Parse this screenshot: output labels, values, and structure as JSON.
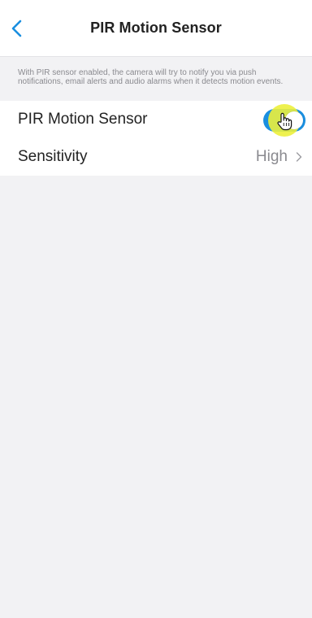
{
  "header": {
    "title": "PIR Motion Sensor"
  },
  "description": "With PIR sensor enabled, the camera will try to notify you via push notifications, email alerts and audio alarms when it detects motion events.",
  "settings": {
    "pir": {
      "label": "PIR Motion Sensor",
      "enabled": true
    },
    "sensitivity": {
      "label": "Sensitivity",
      "value": "High"
    }
  },
  "icons": {
    "back": "chevron-left-icon",
    "disclosure": "chevron-right-icon",
    "cursor": "hand-cursor-icon"
  },
  "colors": {
    "accent": "#1a8fe0",
    "highlight": "#ecf03c",
    "background": "#f2f2f4"
  }
}
